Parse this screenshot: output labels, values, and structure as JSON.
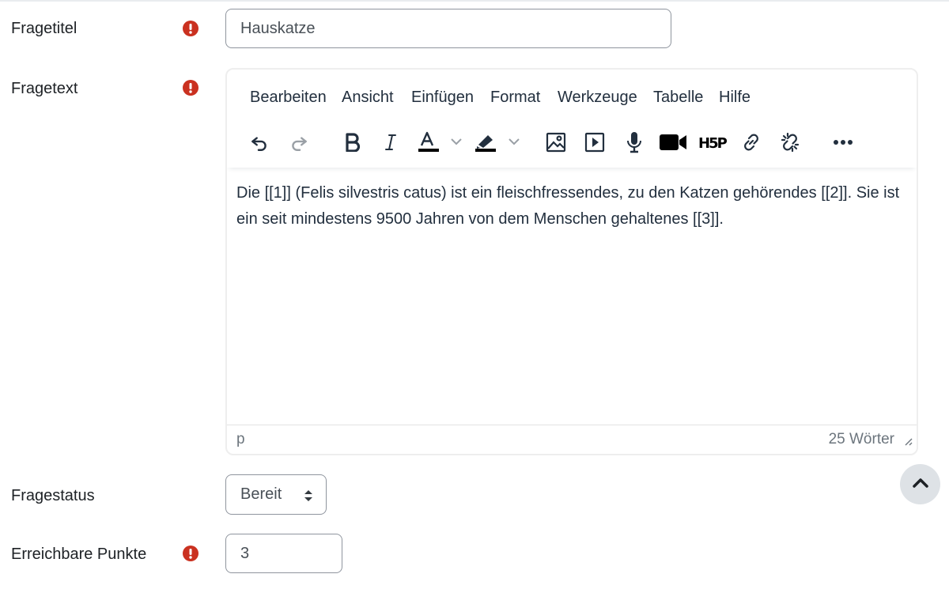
{
  "form": {
    "title_label": "Fragetitel",
    "title_value": "Hauskatze",
    "text_label": "Fragetext",
    "status_label": "Fragestatus",
    "status_value": "Bereit",
    "points_label": "Erreichbare Punkte",
    "points_value": "3"
  },
  "editor": {
    "menu": [
      "Bearbeiten",
      "Ansicht",
      "Einfügen",
      "Format",
      "Werkzeuge",
      "Tabelle",
      "Hilfe"
    ],
    "content": "Die [[1]] (Felis silvestris catus) ist ein fleischfressendes, zu den Katzen gehörendes [[2]]. Sie ist ein seit mindestens 9500 Jahren von dem Menschen gehaltenes [[3]].",
    "status_path": "p",
    "word_count": "25 Wörter",
    "h5p_label": "H5P"
  },
  "colors": {
    "required_icon": "#ca3120",
    "border": "#8f959e",
    "back_to_top_bg": "#dee2e6"
  },
  "icons": {
    "required": "exclamation-circle-icon",
    "back_to_top": "chevron-up-icon"
  }
}
